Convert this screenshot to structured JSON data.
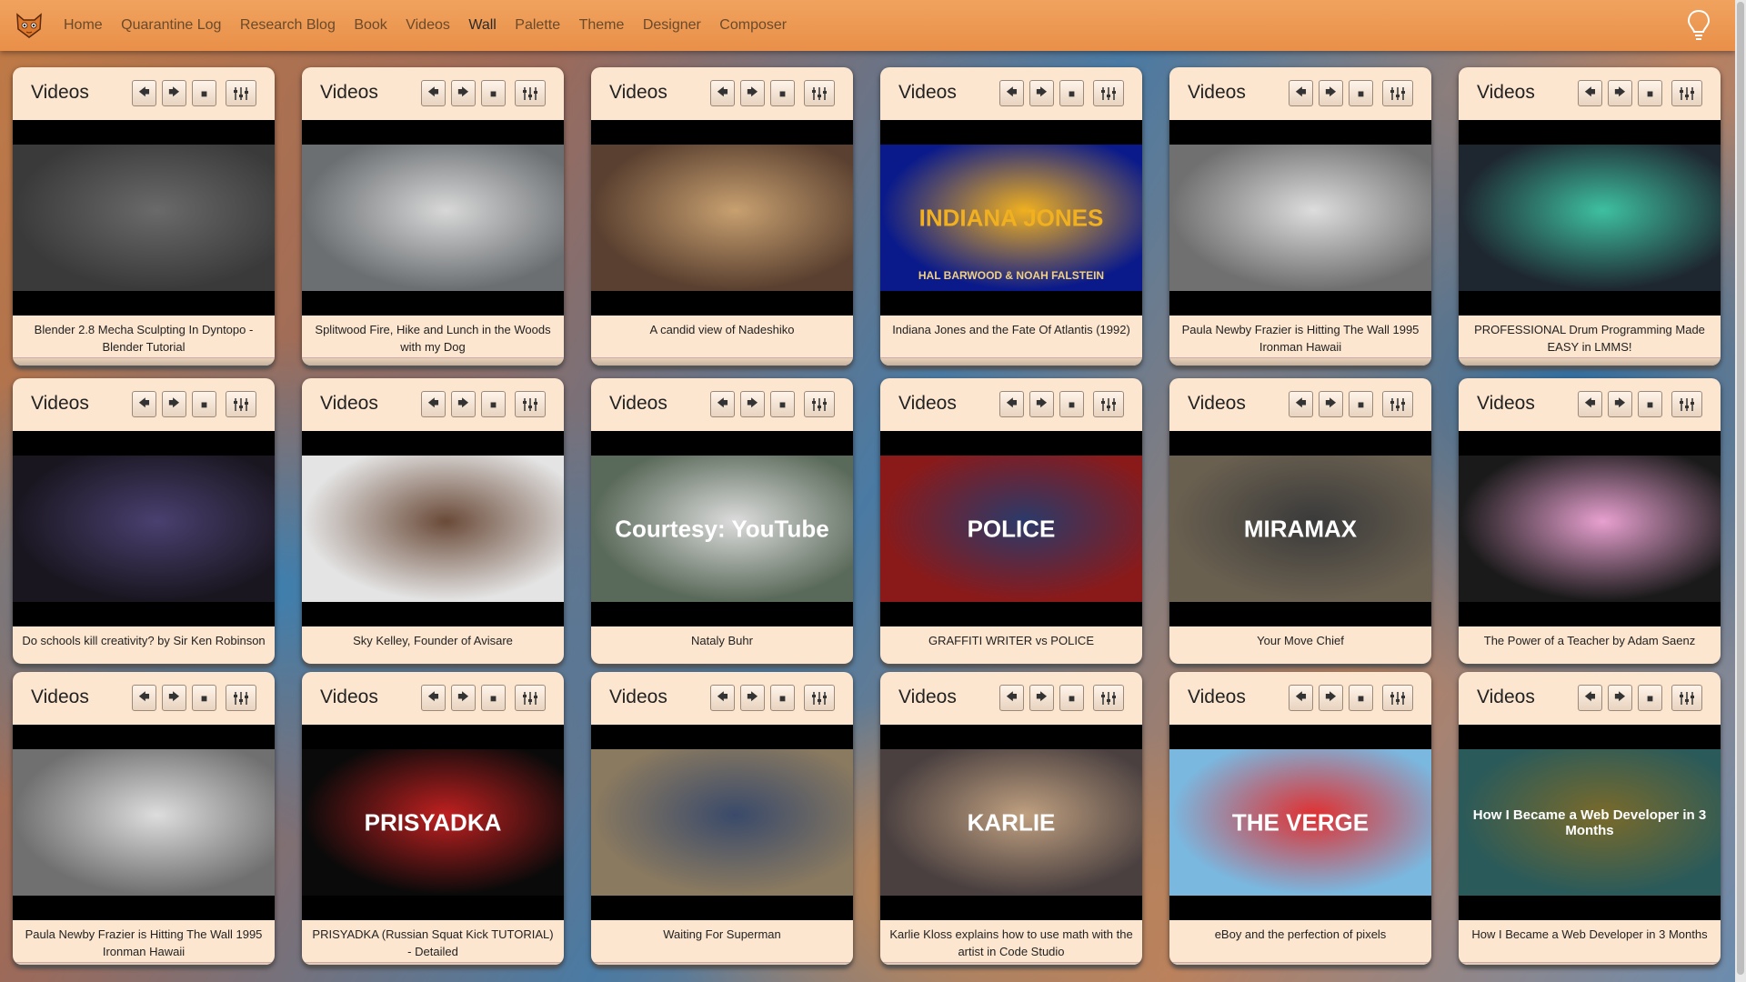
{
  "nav": {
    "items": [
      "Home",
      "Quarantine Log",
      "Research Blog",
      "Book",
      "Videos",
      "Wall",
      "Palette",
      "Theme",
      "Designer",
      "Composer"
    ],
    "active": "Wall"
  },
  "card_title": "Videos",
  "cards": [
    {
      "caption": "Blender 2.8 Mecha Sculpting In Dyntopo - Blender Tutorial",
      "bg": "#3a3a3a",
      "accent": "#6a6a6a"
    },
    {
      "caption": "Splitwood Fire, Hike and Lunch in the Woods with my Dog",
      "bg": "#6b6f72",
      "accent": "#d8d8d8"
    },
    {
      "caption": "A candid view of Nadeshiko",
      "bg": "#5a4030",
      "accent": "#c8a070"
    },
    {
      "caption": "Indiana Jones and the Fate Of Atlantis (1992)",
      "bg": "#0a1a8a",
      "accent": "#f0b020",
      "overlay": "INDIANA JONES",
      "overlay2": "HAL BARWOOD & NOAH FALSTEIN"
    },
    {
      "caption": "Paula Newby Frazier is Hitting The Wall 1995 Ironman Hawaii",
      "bg": "#707070",
      "accent": "#dddddd"
    },
    {
      "caption": "PROFESSIONAL Drum Programming Made EASY in LMMS!",
      "bg": "#1e2630",
      "accent": "#3ec0a0"
    },
    {
      "caption": "Do schools kill creativity? by Sir Ken Robinson",
      "bg": "#1a1620",
      "accent": "#4a4070"
    },
    {
      "caption": "Sky Kelley, Founder of Avisare",
      "bg": "#e4e4e4",
      "accent": "#6a4a38"
    },
    {
      "caption": "Nataly Buhr",
      "bg": "#5a6a5a",
      "accent": "#dcdcdc",
      "overlay": "Courtesy: YouTube"
    },
    {
      "caption": "GRAFFITI WRITER vs POLICE",
      "bg": "#8a1a1a",
      "accent": "#2a3a6a",
      "overlay": "POLICE"
    },
    {
      "caption": "Your Move Chief",
      "bg": "#6a6050",
      "accent": "#3a3a3a",
      "overlay": "MIRAMAX"
    },
    {
      "caption": "The Power of a Teacher by Adam Saenz",
      "bg": "#1a1a1a",
      "accent": "#e8a0d0"
    },
    {
      "caption": "Paula Newby Frazier is Hitting The Wall 1995 Ironman Hawaii",
      "bg": "#707070",
      "accent": "#dddddd"
    },
    {
      "caption": "PRISYADKA (Russian Squat Kick TUTORIAL) - Detailed",
      "bg": "#0a0a0a",
      "accent": "#c02020",
      "overlay": "PRISYADKA"
    },
    {
      "caption": "Waiting For Superman",
      "bg": "#8a7a60",
      "accent": "#3a4a6a"
    },
    {
      "caption": "Karlie Kloss explains how to use math with the artist in Code Studio",
      "bg": "#4a4040",
      "accent": "#c0a080",
      "overlay": "KARLIE"
    },
    {
      "caption": "eBoy and the perfection of pixels",
      "bg": "#7ab8e0",
      "accent": "#e03030",
      "overlay": "THE VERGE"
    },
    {
      "caption": "How I Became a Web Developer in 3 Months",
      "bg": "#2a5a5a",
      "accent": "#7a6a2a",
      "overlay": "How I Became a Web Developer in 3 Months"
    }
  ]
}
